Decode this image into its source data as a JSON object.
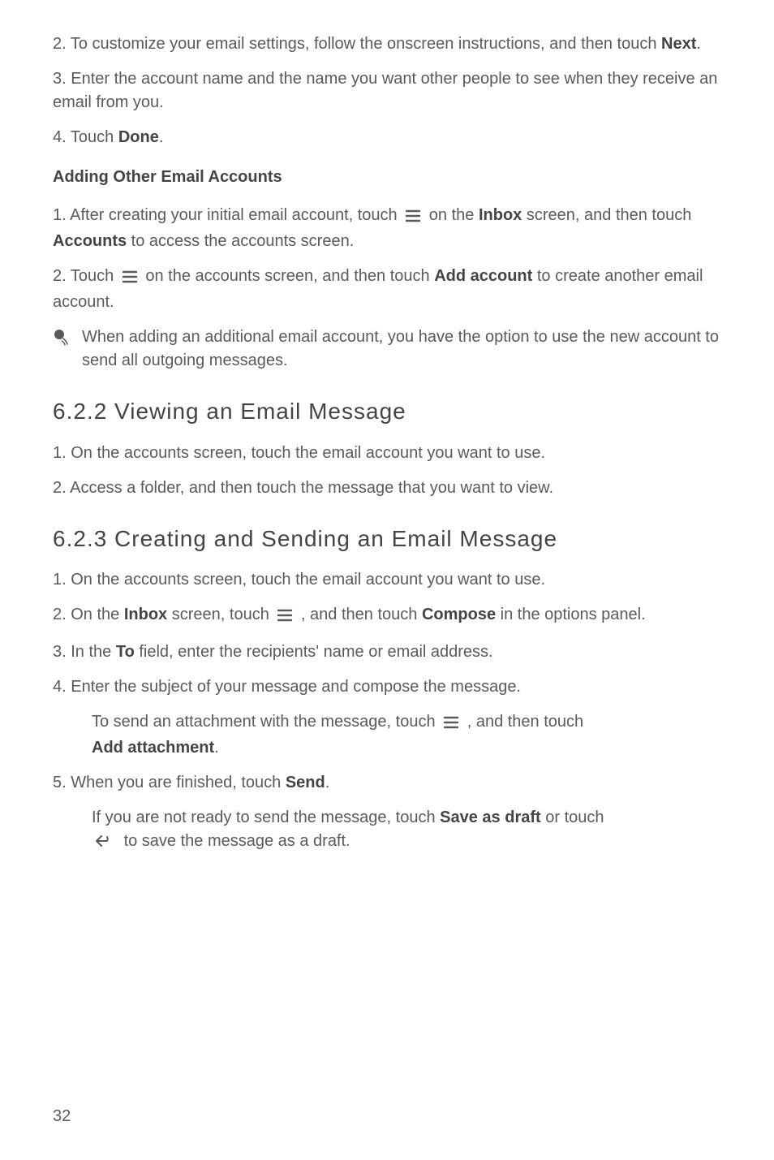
{
  "s1": {
    "step2_a": "2. To customize your email settings, follow the onscreen instructions, and then touch ",
    "step2_b": "Next",
    "step2_c": ".",
    "step3": "3. Enter the account name and the name you want other people to see when they receive an email from you.",
    "step4_a": "4. Touch ",
    "step4_b": "Done",
    "step4_c": "."
  },
  "h_adding": "Adding Other Email Accounts",
  "adding": {
    "step1_a": "1. After creating your initial email account, touch ",
    "step1_b": " on the ",
    "step1_c": "Inbox",
    "step1_d": " screen, and then touch ",
    "step1_e": "Accounts",
    "step1_f": " to access the accounts screen.",
    "step2_a": "2. Touch ",
    "step2_b": " on the accounts screen, and then touch ",
    "step2_c": "Add account",
    "step2_d": " to create another email account."
  },
  "note1": "When adding an additional email account, you have the option to use the new account to send all outgoing messages.",
  "h_622": "6.2.2  Viewing an Email Message",
  "view": {
    "step1": "1. On the accounts screen, touch the email account you want to use.",
    "step2": "2. Access a folder, and then touch the message that you want to view."
  },
  "h_623": "6.2.3  Creating and Sending an Email Message",
  "create": {
    "step1": "1. On the accounts screen, touch the email account you want to use.",
    "step2_a": "2. On the ",
    "step2_b": "Inbox",
    "step2_c": " screen, touch ",
    "step2_d": " , and then touch ",
    "step2_e": "Compose",
    "step2_f": " in the options panel.",
    "step3_a": "3. In the ",
    "step3_b": "To",
    "step3_c": " field, enter the recipients' name or email address.",
    "step4": "4. Enter the subject of your message and compose the message.",
    "attach_a": "To send an attachment with the message, touch ",
    "attach_b": " , and then touch ",
    "attach_c": "Add attachment",
    "attach_d": ".",
    "step5_a": "5. When you are finished, touch ",
    "step5_b": "Send",
    "step5_c": ".",
    "draft_a": "If you are not ready to send the message, touch ",
    "draft_b": "Save as draft",
    "draft_c": " or touch ",
    "draft_d": " to save the message as a draft."
  },
  "page_number": "32"
}
